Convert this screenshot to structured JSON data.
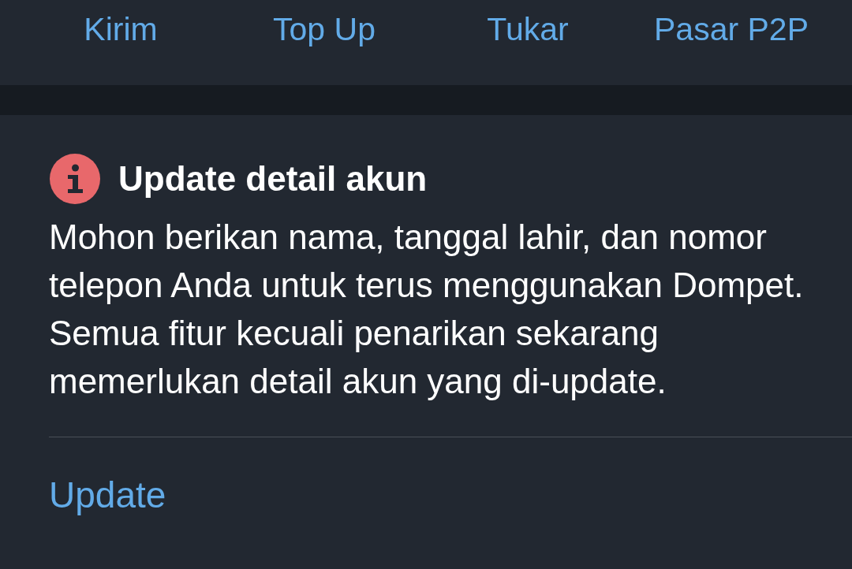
{
  "actions": [
    {
      "label": "Kirim"
    },
    {
      "label": "Top Up"
    },
    {
      "label": "Tukar"
    },
    {
      "label": "Pasar P2P"
    }
  ],
  "notice": {
    "title": "Update detail akun",
    "body": "Mohon berikan nama, tanggal lahir, dan nomor telepon Anda untuk terus menggunakan Dompet. Semua fitur kecuali penarikan sekarang memerlukan detail akun yang di-update.",
    "action": "Update"
  }
}
